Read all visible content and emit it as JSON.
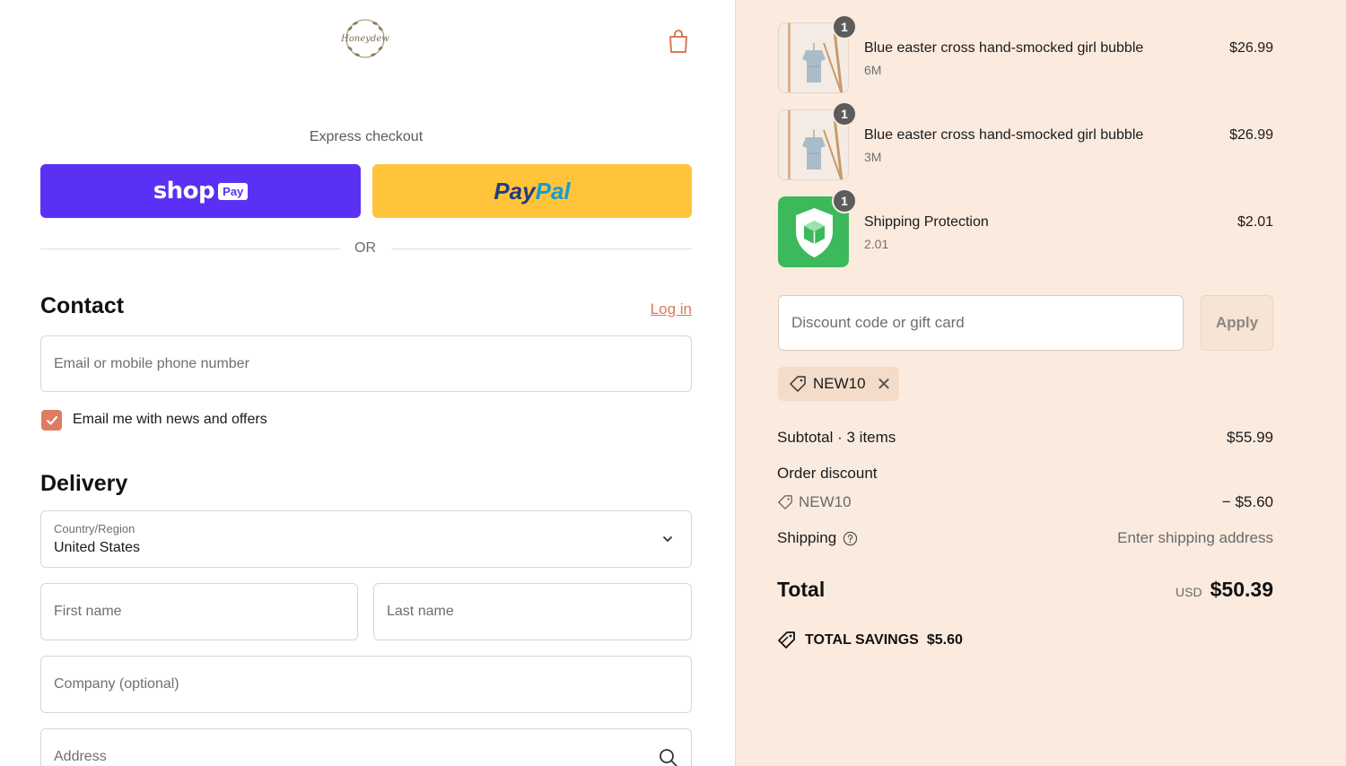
{
  "header": {
    "logo_alt": "Honeydew",
    "cart_icon": "shopping-bag-icon"
  },
  "express": {
    "title": "Express checkout",
    "shop_word": "shop",
    "shop_badge": "Pay",
    "paypal_part1": "Pay",
    "paypal_part2": "Pal",
    "or_label": "OR"
  },
  "contact": {
    "heading": "Contact",
    "login_link": "Log in",
    "email_placeholder": "Email or mobile phone number",
    "newsletter_label": "Email me with news and offers",
    "newsletter_checked": true
  },
  "delivery": {
    "heading": "Delivery",
    "country_label": "Country/Region",
    "country_value": "United States",
    "first_name_placeholder": "First name",
    "last_name_placeholder": "Last name",
    "company_placeholder": "Company (optional)",
    "address_placeholder": "Address"
  },
  "cart": {
    "items": [
      {
        "name": "Blue easter cross hand-smocked girl bubble",
        "variant": "6M",
        "price": "$26.99",
        "qty": "1"
      },
      {
        "name": "Blue easter cross hand-smocked girl bubble",
        "variant": "3M",
        "price": "$26.99",
        "qty": "1"
      },
      {
        "name": "Shipping Protection",
        "variant": "2.01",
        "price": "$2.01",
        "qty": "1"
      }
    ]
  },
  "discount": {
    "placeholder": "Discount code or gift card",
    "apply_label": "Apply",
    "applied_code": "NEW10"
  },
  "summary": {
    "subtotal_label": "Subtotal · 3 items",
    "subtotal_value": "$55.99",
    "order_discount_label": "Order discount",
    "discount_code": "NEW10",
    "discount_value": "− $5.60",
    "shipping_label": "Shipping",
    "shipping_value": "Enter shipping address",
    "total_label": "Total",
    "total_currency": "USD",
    "total_value": "$50.39",
    "savings_label": "TOTAL SAVINGS",
    "savings_value": "$5.60"
  },
  "colors": {
    "shop_pay": "#5a31f4",
    "paypal": "#ffc439",
    "accent": "#e07b62",
    "summary_bg": "#fbebdf"
  }
}
